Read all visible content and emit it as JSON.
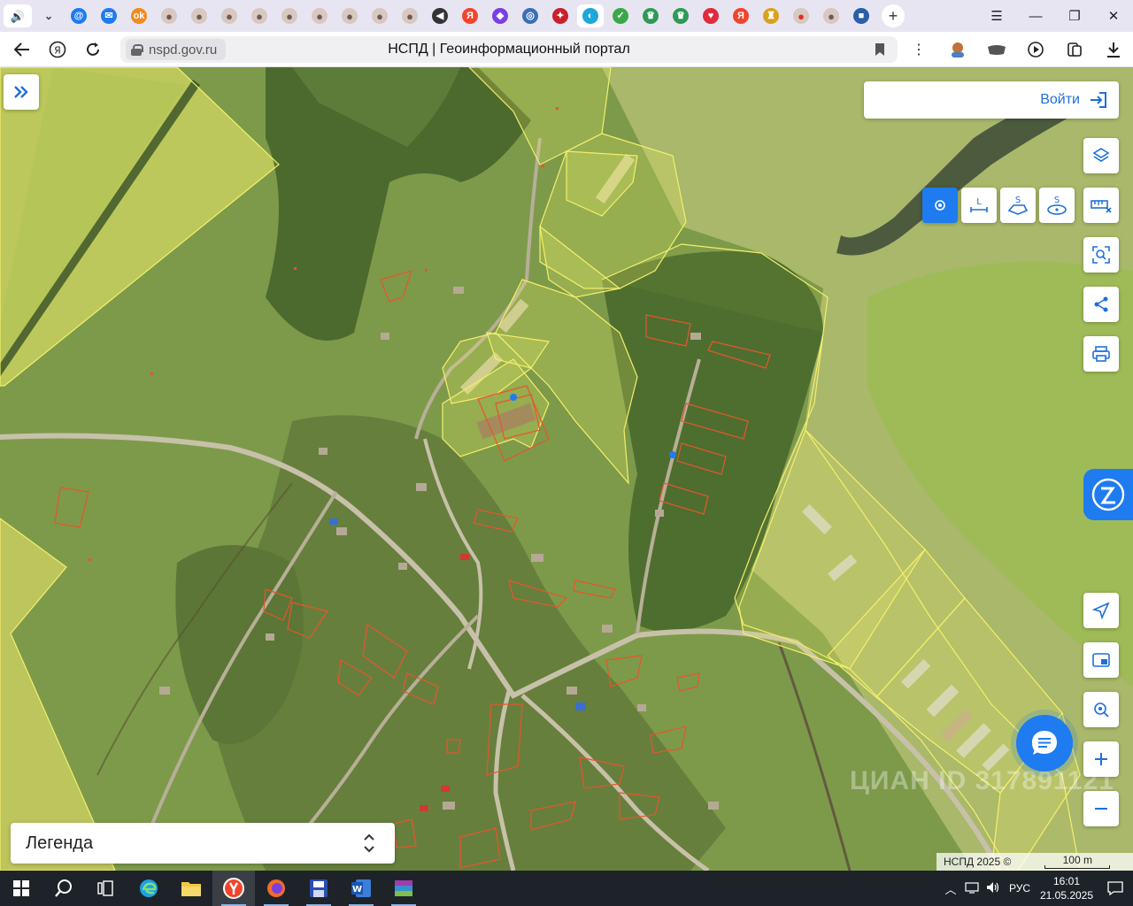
{
  "browser": {
    "tabs": [
      {
        "name": "sound-tab",
        "glyph": "🔊",
        "color": "#ffffff"
      },
      {
        "name": "tabs-dropdown",
        "glyph": "⌄",
        "color": "#ffffff"
      },
      {
        "name": "mail-at-tab",
        "glyph": "@",
        "color": "#1e7bf0"
      },
      {
        "name": "mail-envelope-tab",
        "glyph": "✉",
        "color": "#1e7bf0"
      },
      {
        "name": "ok-tab",
        "glyph": "ok",
        "color": "#f28a1e"
      },
      {
        "name": "avatar-tab-1",
        "glyph": "●",
        "color": "#6b5a55"
      },
      {
        "name": "avatar-tab-2",
        "glyph": "●",
        "color": "#6b5a55"
      },
      {
        "name": "avatar-tab-3",
        "glyph": "●",
        "color": "#6b5a55"
      },
      {
        "name": "avatar-tab-4",
        "glyph": "●",
        "color": "#6b5a55"
      },
      {
        "name": "avatar-tab-5",
        "glyph": "●",
        "color": "#6b5a55"
      },
      {
        "name": "avatar-tab-6",
        "glyph": "●",
        "color": "#6b5a55"
      },
      {
        "name": "avatar-tab-7",
        "glyph": "●",
        "color": "#6b5a55"
      },
      {
        "name": "avatar-tab-8",
        "glyph": "●",
        "color": "#6b5a55"
      },
      {
        "name": "avatar-tab-9",
        "glyph": "●",
        "color": "#6b5a55"
      },
      {
        "name": "audio-tab",
        "glyph": "◀",
        "color": "#333333"
      },
      {
        "name": "yandex-tab-1",
        "glyph": "Я",
        "color": "#f0452c"
      },
      {
        "name": "shield-tab",
        "glyph": "◆",
        "color": "#7b3fe4"
      },
      {
        "name": "emblem-tab",
        "glyph": "◎",
        "color": "#3b6fb6"
      },
      {
        "name": "red-shield-tab",
        "glyph": "✦",
        "color": "#c8202c"
      },
      {
        "name": "nspd-tab",
        "glyph": "◐",
        "color": "#1ea7d9",
        "active": true
      },
      {
        "name": "check-tab",
        "glyph": "✓",
        "color": "#3aa84b"
      },
      {
        "name": "green-emblem-tab-1",
        "glyph": "♛",
        "color": "#2e9a56"
      },
      {
        "name": "green-emblem-tab-2",
        "glyph": "♛",
        "color": "#2e9a56"
      },
      {
        "name": "heart-tab",
        "glyph": "♥",
        "color": "#e02c3c"
      },
      {
        "name": "yandex-tab-2",
        "glyph": "Я",
        "color": "#f0452c"
      },
      {
        "name": "crest-tab",
        "glyph": "♜",
        "color": "#d9a21e"
      },
      {
        "name": "maps-pin-tab",
        "glyph": "●",
        "color": "#e0302c"
      },
      {
        "name": "avatar-tab-10",
        "glyph": "●",
        "color": "#6b5a55"
      },
      {
        "name": "briefcase-tab",
        "glyph": "■",
        "color": "#2b5fa8"
      }
    ],
    "domain": "nspd.gov.ru",
    "page_title": "НСПД | Геоинформационный портал"
  },
  "map": {
    "login_label": "Войти",
    "legend_label": "Легенда",
    "attribution": "НСПД 2025 ©",
    "scale_label": "100 m",
    "watermark": "ЦИАН ID 317891121",
    "measure_tools": [
      {
        "name": "point-measure-tool",
        "label": "",
        "active": true
      },
      {
        "name": "length-measure-tool",
        "label": "L",
        "active": false
      },
      {
        "name": "area-measure-tool",
        "label": "S",
        "active": false
      },
      {
        "name": "circle-area-measure-tool",
        "label": "S",
        "active": false
      }
    ],
    "colors": {
      "accent": "#1e7bf0",
      "parcel_outline": "#f3f06a",
      "building_outline": "#e8552c"
    }
  },
  "taskbar": {
    "language": "РУС",
    "time": "16:01",
    "date": "21.05.2025"
  }
}
